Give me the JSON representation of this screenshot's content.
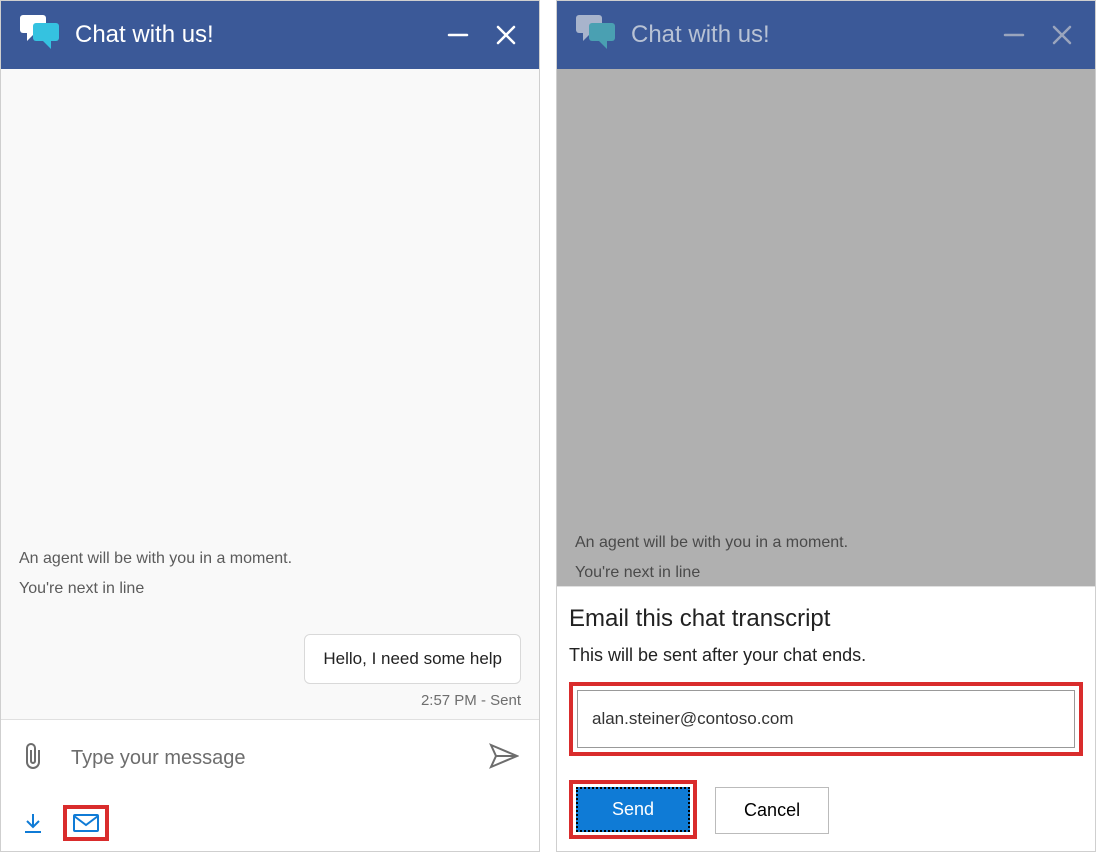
{
  "left": {
    "header": {
      "title": "Chat with us!"
    },
    "system_messages": [
      "An agent will be with you in a moment.",
      "You're next in line"
    ],
    "user_message": "Hello, I need some help",
    "timestamp": "2:57 PM - Sent",
    "input_placeholder": "Type your message"
  },
  "right": {
    "header": {
      "title": "Chat with us!"
    },
    "system_messages": [
      "An agent will be with you in a moment.",
      "You're next in line"
    ],
    "email_panel": {
      "title": "Email this chat transcript",
      "subtitle": "This will be sent after your chat ends.",
      "email_value": "alan.steiner@contoso.com",
      "send_label": "Send",
      "cancel_label": "Cancel"
    }
  },
  "colors": {
    "header_bg": "#3b5998",
    "accent_blue": "#0f7bd6",
    "highlight_red": "#d92c2c",
    "light_icon_blue": "#35c2e0"
  }
}
